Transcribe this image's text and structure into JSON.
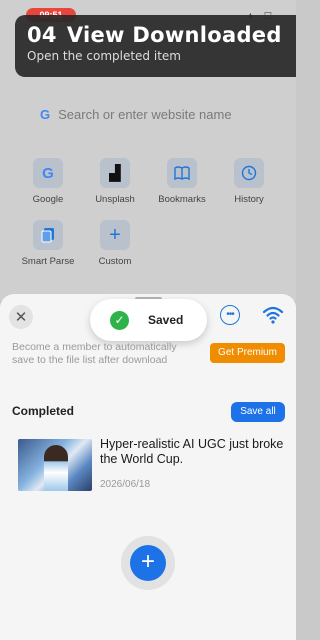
{
  "status_bar": {
    "time": "09:51",
    "icons": "▴ ◻"
  },
  "step": {
    "number": "04",
    "title": "View Downloaded",
    "subtitle": "Open the completed item"
  },
  "search": {
    "logo": "G",
    "placeholder": "Search or enter website name"
  },
  "shortcuts": [
    {
      "label": "Google",
      "icon": "google-icon",
      "glyph": "G",
      "color": "#4285f4"
    },
    {
      "label": "Unsplash",
      "icon": "unsplash-icon",
      "glyph": "▟",
      "color": "#111111"
    },
    {
      "label": "Bookmarks",
      "icon": "bookmarks-icon",
      "glyph": "📖",
      "color": "#2176d9"
    },
    {
      "label": "History",
      "icon": "history-icon",
      "glyph": "◷",
      "color": "#2176d9"
    },
    {
      "label": "Smart Parse",
      "icon": "smart-parse-icon",
      "glyph": "❐",
      "color": "#2176d9"
    },
    {
      "label": "Custom",
      "icon": "add-icon",
      "glyph": "+",
      "color": "#2176d9"
    }
  ],
  "sheet": {
    "close_glyph": "✕",
    "toast": {
      "check_glyph": "✓",
      "label": "Saved"
    },
    "more_glyph": "•••",
    "member_text": "Become a member to automatically save to the file list after download",
    "premium_label": "Get Premium",
    "completed_title": "Completed",
    "save_all_label": "Save all",
    "items": [
      {
        "title": "Hyper-realistic AI UGC just broke the World Cup.",
        "date": "2026/06/18"
      }
    ],
    "fab_glyph": "+"
  },
  "colors": {
    "accent": "#1d72e8",
    "premium": "#f08c00",
    "success": "#2db34a"
  }
}
